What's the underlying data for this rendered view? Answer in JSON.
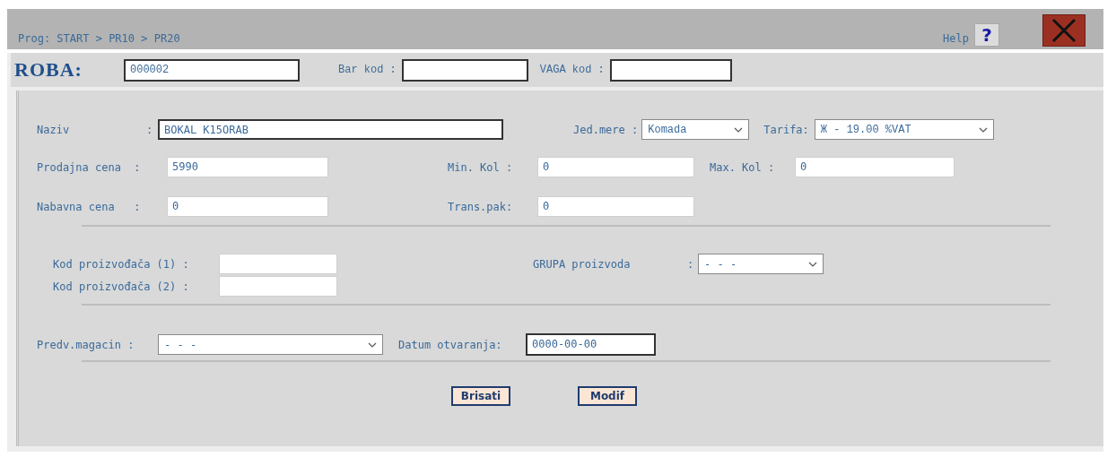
{
  "breadcrumb": "Prog: START > PR10 > PR20",
  "help": {
    "label": "Help",
    "icon": "?"
  },
  "header": {
    "title": "ROBA:",
    "code": "000002",
    "fields": [
      {
        "label": "Bar kod :"
      },
      {
        "label": "VAGA kod :"
      }
    ]
  },
  "naziv": {
    "label": "Naziv",
    "colon": ":",
    "value": "BOKAL K15ORAB"
  },
  "jed_mere": {
    "label": "Jed.mere :",
    "value": "Komada"
  },
  "tarifa": {
    "label": "Tarifa:",
    "value": "Ж - 19.00 %VAT"
  },
  "price_rows": [
    [
      {
        "label": "Prodajna cena  :",
        "value": "5990"
      },
      {
        "label": "Min. Kol :",
        "value": "0"
      },
      {
        "label": "Max. Kol :",
        "value": "0"
      }
    ],
    [
      {
        "label": "Nabavna cena   :",
        "value": "0"
      },
      {
        "label": "Trans.pak:",
        "value": "0"
      }
    ]
  ],
  "producer_codes": [
    {
      "label": "Kod proizvođača (1) :"
    },
    {
      "label": "Kod proizvođača (2) :"
    }
  ],
  "grupa": {
    "label": "GRUPA proizvoda",
    "colon": ":",
    "value": "- - -"
  },
  "magacin": {
    "label": "Predv.magacin :",
    "value": "- - -"
  },
  "datum": {
    "label": "Datum otvaranja:",
    "value": "0000-00-00"
  },
  "buttons": [
    "Brisati",
    "Modif"
  ]
}
